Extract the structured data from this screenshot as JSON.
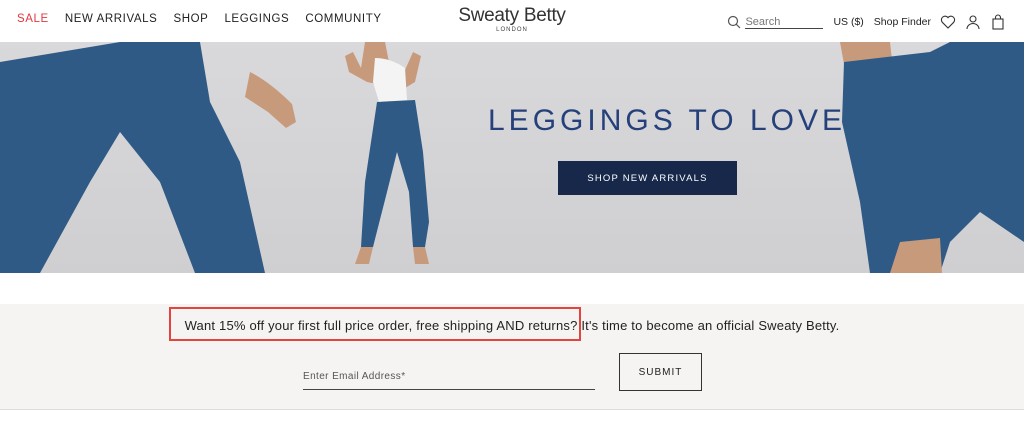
{
  "nav": {
    "items": [
      {
        "label": "SALE"
      },
      {
        "label": "NEW ARRIVALS"
      },
      {
        "label": "SHOP"
      },
      {
        "label": "LEGGINGS"
      },
      {
        "label": "COMMUNITY"
      }
    ]
  },
  "logo": {
    "name": "Sweaty Betty",
    "sub": "LONDON"
  },
  "utility": {
    "search_placeholder": "Search",
    "currency": "US ($)",
    "shop_finder": "Shop Finder",
    "icons": [
      "search-icon",
      "heart-icon",
      "account-icon",
      "bag-icon"
    ]
  },
  "hero": {
    "title": "LEGGINGS TO LOVE",
    "button_label": "SHOP NEW ARRIVALS",
    "colors": {
      "title": "#25407b",
      "button": "#17284a",
      "sale": "#e0393e"
    }
  },
  "signup": {
    "promo_text": "Want 15% off your first full price order, free shipping AND returns? It's time to become an official Sweaty Betty.",
    "email_placeholder": "Enter Email Address*",
    "submit_label": "SUBMIT"
  }
}
